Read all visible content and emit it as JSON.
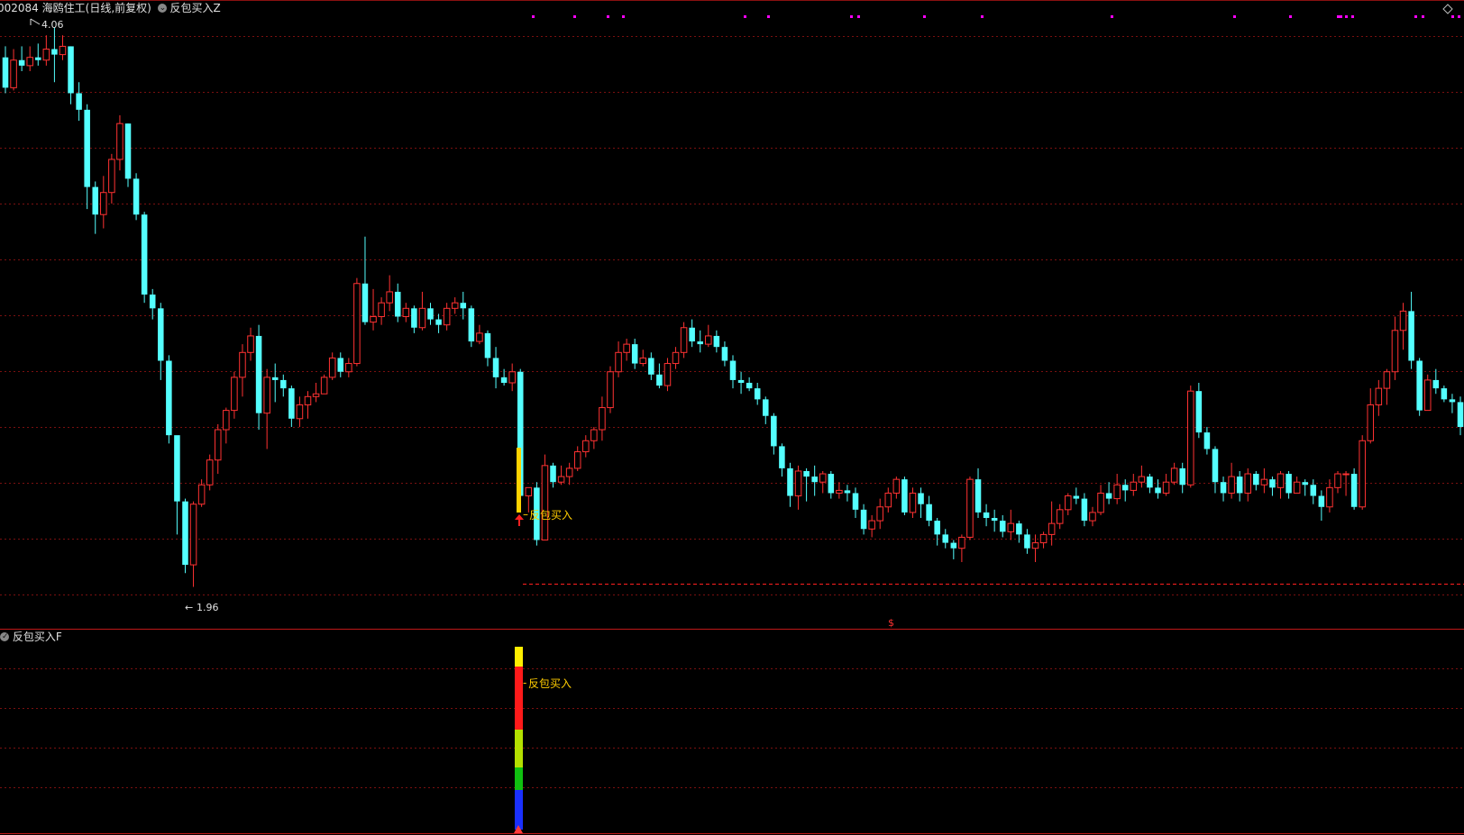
{
  "header": {
    "stock_code": "002084",
    "stock_name": "海鸥住工",
    "period_label": "(日线,前复权)",
    "indicator_main": "反包买入Z",
    "indicator_sub": "反包买入F"
  },
  "annotations": {
    "high_label": "4.06",
    "low_label": "1.96",
    "signal_label_main": "反包买入",
    "signal_label_sub": "反包买入",
    "dollar_marker": "$"
  },
  "colors": {
    "background": "#000000",
    "up_candle": "#ff3232",
    "down_candle": "#54ffff",
    "grid": "#7a1010",
    "support_line": "#ff2020",
    "signal_text": "#ffcc00",
    "marker_dots": "#ff00ff",
    "header_text": "#e0e0e0"
  },
  "chart_data": {
    "type": "candlestick",
    "price_range": [
      1.96,
      4.06
    ],
    "support_level": 2.04,
    "candles": [
      [
        3.95,
        3.84,
        3.99,
        3.82
      ],
      [
        3.84,
        3.94,
        3.98,
        3.83
      ],
      [
        3.94,
        3.92,
        3.99,
        3.9
      ],
      [
        3.92,
        3.95,
        3.99,
        3.9
      ],
      [
        3.95,
        3.94,
        4.0,
        3.92
      ],
      [
        3.94,
        3.98,
        4.03,
        3.92
      ],
      [
        3.98,
        3.96,
        4.06,
        3.86
      ],
      [
        3.96,
        3.99,
        4.03,
        3.94
      ],
      [
        3.99,
        3.82,
        3.99,
        3.78
      ],
      [
        3.82,
        3.76,
        3.86,
        3.72
      ],
      [
        3.76,
        3.48,
        3.78,
        3.4
      ],
      [
        3.48,
        3.38,
        3.5,
        3.31
      ],
      [
        3.38,
        3.46,
        3.52,
        3.33
      ],
      [
        3.46,
        3.58,
        3.6,
        3.42
      ],
      [
        3.58,
        3.71,
        3.74,
        3.54
      ],
      [
        3.71,
        3.51,
        3.71,
        3.48
      ],
      [
        3.51,
        3.38,
        3.53,
        3.36
      ],
      [
        3.38,
        3.09,
        3.39,
        3.06
      ],
      [
        3.09,
        3.04,
        3.11,
        3.0
      ],
      [
        3.04,
        2.85,
        3.06,
        2.78
      ],
      [
        2.85,
        2.58,
        2.87,
        2.55
      ],
      [
        2.58,
        2.34,
        2.41,
        2.22
      ],
      [
        2.34,
        2.11,
        2.35,
        2.08
      ],
      [
        2.11,
        2.33,
        2.34,
        2.03
      ],
      [
        2.33,
        2.4,
        2.42,
        2.32
      ],
      [
        2.4,
        2.49,
        2.51,
        2.38
      ],
      [
        2.49,
        2.6,
        2.62,
        2.44
      ],
      [
        2.6,
        2.67,
        2.68,
        2.55
      ],
      [
        2.67,
        2.79,
        2.81,
        2.64
      ],
      [
        2.79,
        2.88,
        2.91,
        2.72
      ],
      [
        2.88,
        2.94,
        2.97,
        2.85
      ],
      [
        2.94,
        2.66,
        2.98,
        2.6
      ],
      [
        2.66,
        2.79,
        2.82,
        2.53
      ],
      [
        2.79,
        2.78,
        2.84,
        2.7
      ],
      [
        2.78,
        2.75,
        2.8,
        2.72
      ],
      [
        2.75,
        2.64,
        2.76,
        2.61
      ],
      [
        2.64,
        2.69,
        2.72,
        2.61
      ],
      [
        2.69,
        2.72,
        2.74,
        2.64
      ],
      [
        2.72,
        2.73,
        2.77,
        2.7
      ],
      [
        2.73,
        2.79,
        2.8,
        2.74
      ],
      [
        2.79,
        2.86,
        2.88,
        2.78
      ],
      [
        2.86,
        2.81,
        2.88,
        2.79
      ],
      [
        2.81,
        2.84,
        2.86,
        2.79
      ],
      [
        2.84,
        3.13,
        3.15,
        2.83
      ],
      [
        3.13,
        2.99,
        3.3,
        2.98
      ],
      [
        2.99,
        3.01,
        3.11,
        2.96
      ],
      [
        3.01,
        3.06,
        3.08,
        2.98
      ],
      [
        3.06,
        3.1,
        3.16,
        3.03
      ],
      [
        3.1,
        3.01,
        3.13,
        2.99
      ],
      [
        3.01,
        3.04,
        3.06,
        2.99
      ],
      [
        3.04,
        2.97,
        3.05,
        2.95
      ],
      [
        2.97,
        3.04,
        3.1,
        2.96
      ],
      [
        3.04,
        3.0,
        3.06,
        2.98
      ],
      [
        3.0,
        2.98,
        3.02,
        2.95
      ],
      [
        2.98,
        3.04,
        3.06,
        2.96
      ],
      [
        3.04,
        3.06,
        3.08,
        3.02
      ],
      [
        3.06,
        3.04,
        3.1,
        3.0
      ],
      [
        3.04,
        2.92,
        3.05,
        2.9
      ],
      [
        2.92,
        2.95,
        2.98,
        2.91
      ],
      [
        2.95,
        2.86,
        2.96,
        2.83
      ],
      [
        2.86,
        2.79,
        2.9,
        2.75
      ],
      [
        2.79,
        2.77,
        2.82,
        2.76
      ],
      [
        2.77,
        2.81,
        2.84,
        2.74
      ],
      [
        2.81,
        2.36,
        2.82,
        2.33
      ],
      [
        2.36,
        2.39,
        2.38,
        2.3
      ],
      [
        2.39,
        2.2,
        2.41,
        2.18
      ],
      [
        2.2,
        2.47,
        2.51,
        2.43
      ],
      [
        2.47,
        2.41,
        2.48,
        2.39
      ],
      [
        2.41,
        2.43,
        2.47,
        2.4
      ],
      [
        2.43,
        2.46,
        2.48,
        2.4
      ],
      [
        2.46,
        2.52,
        2.54,
        2.45
      ],
      [
        2.52,
        2.56,
        2.58,
        2.5
      ],
      [
        2.56,
        2.6,
        2.61,
        2.53
      ],
      [
        2.6,
        2.68,
        2.72,
        2.56
      ],
      [
        2.68,
        2.81,
        2.83,
        2.66
      ],
      [
        2.81,
        2.88,
        2.92,
        2.79
      ],
      [
        2.88,
        2.91,
        2.93,
        2.85
      ],
      [
        2.91,
        2.84,
        2.93,
        2.82
      ],
      [
        2.84,
        2.86,
        2.89,
        2.83
      ],
      [
        2.86,
        2.8,
        2.88,
        2.78
      ],
      [
        2.8,
        2.76,
        2.84,
        2.75
      ],
      [
        2.76,
        2.84,
        2.86,
        2.74
      ],
      [
        2.84,
        2.88,
        2.9,
        2.82
      ],
      [
        2.88,
        2.97,
        2.99,
        2.86
      ],
      [
        2.97,
        2.92,
        3.0,
        2.9
      ],
      [
        2.92,
        2.91,
        2.96,
        2.88
      ],
      [
        2.91,
        2.94,
        2.98,
        2.9
      ],
      [
        2.94,
        2.9,
        2.96,
        2.88
      ],
      [
        2.9,
        2.85,
        2.92,
        2.83
      ],
      [
        2.85,
        2.78,
        2.87,
        2.75
      ],
      [
        2.78,
        2.77,
        2.81,
        2.73
      ],
      [
        2.77,
        2.75,
        2.79,
        2.74
      ],
      [
        2.75,
        2.71,
        2.77,
        2.69
      ],
      [
        2.71,
        2.65,
        2.72,
        2.62
      ],
      [
        2.65,
        2.54,
        2.66,
        2.51
      ],
      [
        2.54,
        2.46,
        2.55,
        2.43
      ],
      [
        2.46,
        2.36,
        2.48,
        2.32
      ],
      [
        2.36,
        2.45,
        2.47,
        2.31
      ],
      [
        2.45,
        2.43,
        2.46,
        2.34
      ],
      [
        2.43,
        2.41,
        2.47,
        2.36
      ],
      [
        2.41,
        2.44,
        2.45,
        2.37
      ],
      [
        2.44,
        2.37,
        2.45,
        2.35
      ],
      [
        2.37,
        2.38,
        2.41,
        2.35
      ],
      [
        2.38,
        2.37,
        2.4,
        2.34
      ],
      [
        2.37,
        2.31,
        2.39,
        2.28
      ],
      [
        2.31,
        2.24,
        2.33,
        2.22
      ],
      [
        2.24,
        2.27,
        2.29,
        2.21
      ],
      [
        2.27,
        2.32,
        2.35,
        2.24
      ],
      [
        2.32,
        2.37,
        2.39,
        2.3
      ],
      [
        2.37,
        2.42,
        2.43,
        2.35
      ],
      [
        2.42,
        2.3,
        2.43,
        2.29
      ],
      [
        2.3,
        2.37,
        2.39,
        2.28
      ],
      [
        2.37,
        2.33,
        2.39,
        2.28
      ],
      [
        2.33,
        2.27,
        2.36,
        2.25
      ],
      [
        2.27,
        2.22,
        2.28,
        2.18
      ],
      [
        2.22,
        2.19,
        2.24,
        2.17
      ],
      [
        2.19,
        2.17,
        2.2,
        2.13
      ],
      [
        2.17,
        2.21,
        2.22,
        2.12
      ],
      [
        2.21,
        2.42,
        2.43,
        2.2
      ],
      [
        2.42,
        2.3,
        2.46,
        2.28
      ],
      [
        2.3,
        2.28,
        2.33,
        2.25
      ],
      [
        2.28,
        2.27,
        2.31,
        2.23
      ],
      [
        2.27,
        2.23,
        2.29,
        2.21
      ],
      [
        2.23,
        2.26,
        2.31,
        2.2
      ],
      [
        2.26,
        2.22,
        2.27,
        2.19
      ],
      [
        2.22,
        2.17,
        2.24,
        2.15
      ],
      [
        2.17,
        2.19,
        2.22,
        2.12
      ],
      [
        2.19,
        2.22,
        2.23,
        2.17
      ],
      [
        2.22,
        2.26,
        2.34,
        2.18
      ],
      [
        2.26,
        2.31,
        2.33,
        2.24
      ],
      [
        2.31,
        2.36,
        2.37,
        2.29
      ],
      [
        2.36,
        2.35,
        2.39,
        2.33
      ],
      [
        2.35,
        2.27,
        2.37,
        2.25
      ],
      [
        2.27,
        2.3,
        2.32,
        2.25
      ],
      [
        2.3,
        2.37,
        2.4,
        2.29
      ],
      [
        2.37,
        2.35,
        2.41,
        2.33
      ],
      [
        2.35,
        2.4,
        2.44,
        2.33
      ],
      [
        2.4,
        2.38,
        2.42,
        2.34
      ],
      [
        2.38,
        2.41,
        2.44,
        2.36
      ],
      [
        2.41,
        2.43,
        2.47,
        2.39
      ],
      [
        2.43,
        2.39,
        2.44,
        2.37
      ],
      [
        2.39,
        2.37,
        2.42,
        2.35
      ],
      [
        2.37,
        2.41,
        2.44,
        2.36
      ],
      [
        2.41,
        2.46,
        2.48,
        2.4
      ],
      [
        2.46,
        2.4,
        2.48,
        2.37
      ],
      [
        2.4,
        2.74,
        2.76,
        2.39
      ],
      [
        2.74,
        2.59,
        2.77,
        2.57
      ],
      [
        2.59,
        2.53,
        2.61,
        2.51
      ],
      [
        2.53,
        2.41,
        2.54,
        2.37
      ],
      [
        2.41,
        2.37,
        2.43,
        2.34
      ],
      [
        2.37,
        2.43,
        2.48,
        2.35
      ],
      [
        2.43,
        2.37,
        2.45,
        2.34
      ],
      [
        2.37,
        2.44,
        2.46,
        2.34
      ],
      [
        2.44,
        2.4,
        2.45,
        2.38
      ],
      [
        2.4,
        2.42,
        2.46,
        2.37
      ],
      [
        2.42,
        2.39,
        2.43,
        2.36
      ],
      [
        2.39,
        2.44,
        2.45,
        2.35
      ],
      [
        2.44,
        2.37,
        2.45,
        2.35
      ],
      [
        2.37,
        2.41,
        2.43,
        2.37
      ],
      [
        2.41,
        2.4,
        2.42,
        2.36
      ],
      [
        2.4,
        2.36,
        2.42,
        2.33
      ],
      [
        2.36,
        2.32,
        2.38,
        2.27
      ],
      [
        2.32,
        2.39,
        2.42,
        2.3
      ],
      [
        2.39,
        2.44,
        2.45,
        2.37
      ],
      [
        2.44,
        2.44,
        2.45,
        2.36
      ],
      [
        2.44,
        2.32,
        2.46,
        2.31
      ],
      [
        2.32,
        2.56,
        2.58,
        2.31
      ],
      [
        2.56,
        2.69,
        2.75,
        2.55
      ],
      [
        2.69,
        2.75,
        2.78,
        2.65
      ],
      [
        2.75,
        2.81,
        2.82,
        2.69
      ],
      [
        2.81,
        2.96,
        3.01,
        2.78
      ],
      [
        2.96,
        3.03,
        3.06,
        2.89
      ],
      [
        3.03,
        2.85,
        3.1,
        2.82
      ],
      [
        2.85,
        2.67,
        2.86,
        2.65
      ],
      [
        2.67,
        2.78,
        2.8,
        2.71
      ],
      [
        2.78,
        2.75,
        2.82,
        2.73
      ],
      [
        2.75,
        2.71,
        2.76,
        2.7
      ],
      [
        2.71,
        2.7,
        2.73,
        2.66
      ],
      [
        2.7,
        2.61,
        2.72,
        2.58
      ]
    ],
    "signal_candle_index": 65,
    "upper_markers_count": 26
  }
}
